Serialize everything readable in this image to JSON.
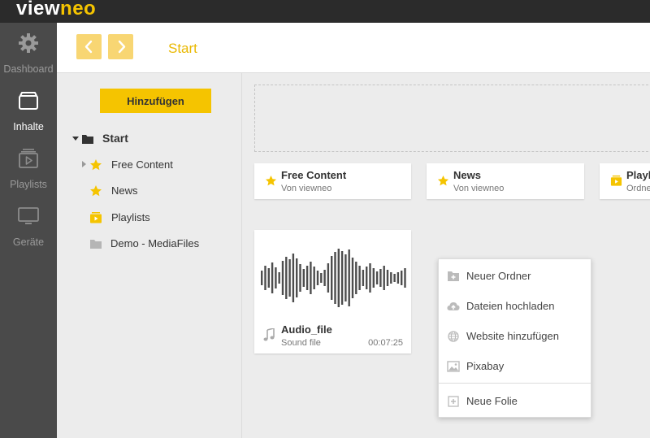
{
  "app": {
    "logo_view": "view",
    "logo_neo": "neo"
  },
  "colors": {
    "accent": "#f5c400",
    "accent_light": "#f8d673",
    "sidebar_bg": "#4a4a4a",
    "topbar_bg": "#2b2b2b"
  },
  "sidebar": {
    "items": [
      {
        "label": "Dashboard",
        "icon": "gear-icon"
      },
      {
        "label": "Inhalte",
        "icon": "inbox-icon",
        "active": true
      },
      {
        "label": "Playlists",
        "icon": "playlist-icon"
      },
      {
        "label": "Geräte",
        "icon": "monitor-icon"
      }
    ]
  },
  "header": {
    "title": "Start",
    "back_icon": "chevron-left-icon",
    "forward_icon": "chevron-right-icon"
  },
  "tree": {
    "add_label": "Hinzufügen",
    "root": "Start",
    "items": [
      {
        "label": "Free Content",
        "icon": "star-icon"
      },
      {
        "label": "News",
        "icon": "star-icon"
      },
      {
        "label": "Playlists",
        "icon": "playlist-folder-icon"
      },
      {
        "label": "Demo - MediaFiles",
        "icon": "folder-icon"
      }
    ]
  },
  "content": {
    "cards": [
      {
        "title": "Free Content",
        "subtitle": "Von viewneo",
        "icon": "star-icon"
      },
      {
        "title": "News",
        "subtitle": "Von viewneo",
        "icon": "star-icon"
      },
      {
        "title": "Playl",
        "subtitle": "Ordne",
        "icon": "playlist-folder-icon"
      }
    ],
    "media": {
      "title": "Audio_file",
      "subtitle": "Sound file",
      "duration": "00:07:25",
      "icon": "music-note-icon"
    }
  },
  "context_menu": {
    "items": [
      {
        "label": "Neuer Ordner",
        "icon": "new-folder-icon"
      },
      {
        "label": "Dateien hochladen",
        "icon": "cloud-upload-icon"
      },
      {
        "label": "Website hinzufügen",
        "icon": "globe-icon"
      },
      {
        "label": "Pixabay",
        "icon": "image-icon"
      },
      {
        "label": "Neue Folie",
        "icon": "new-slide-icon"
      }
    ]
  }
}
